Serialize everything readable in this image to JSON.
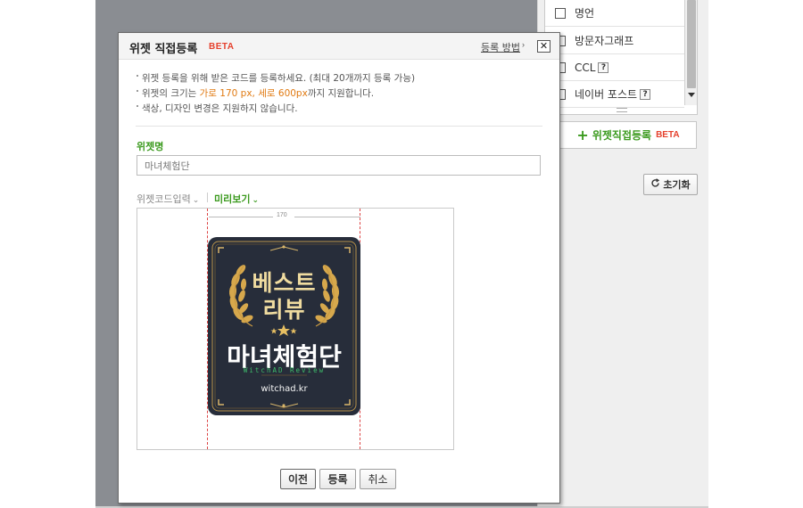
{
  "background_colors": {
    "dim_overlay": "#8a8d92",
    "accent_green": "#3b9a1e",
    "beta_red": "#e5412d",
    "highlight_orange": "#e07a12"
  },
  "widget_list": {
    "items": [
      {
        "label": "명언",
        "has_help": false
      },
      {
        "label": "방문자그래프",
        "has_help": false
      },
      {
        "label": "CCL",
        "has_help": true,
        "help": "?"
      },
      {
        "label": "네이버 포스트",
        "has_help": true,
        "help": "?"
      }
    ]
  },
  "add_widget_button": {
    "plus_icon": "plus-icon",
    "label": "위젯직접등록",
    "beta": "BETA"
  },
  "reset_button": {
    "icon": "refresh-icon",
    "label": "초기화"
  },
  "dialog": {
    "title": "위젯 직접등록",
    "beta": "BETA",
    "help_link": "등록 방법",
    "help_arrow": "›",
    "close": "✕",
    "notes": {
      "line1": "위젯 등록을 위해 받은 코드를 등록하세요. (최대 20개까지 등록 가능)",
      "line2_prefix": "위젯의 크기는 ",
      "line2_highlight": "가로 170 px, 세로 600px",
      "line2_suffix": "까지 지원합니다.",
      "line3": "색상, 디자인 변경은 지원하지 않습니다."
    },
    "name_label": "위젯명",
    "name_value": "마녀체험단",
    "tabs": {
      "code": "위젯코드입력",
      "preview": "미리보기",
      "chevron": "⌄"
    },
    "preview": {
      "width_label": "170",
      "badge": {
        "line1": "베스트",
        "line2": "리뷰",
        "title": "마녀체험단",
        "subtitle": "WitchAD Review",
        "url": "witchad.kr"
      }
    },
    "buttons": {
      "prev": "이전",
      "register": "등록",
      "cancel": "취소"
    }
  }
}
